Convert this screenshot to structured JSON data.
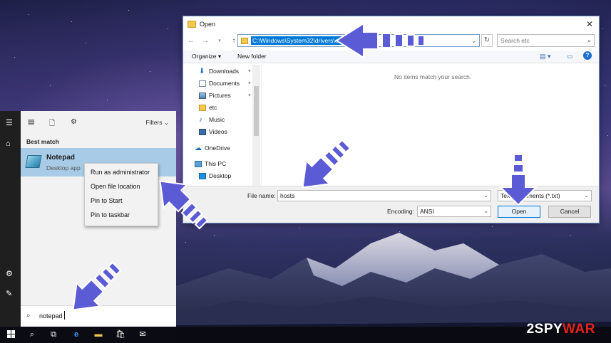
{
  "dialog": {
    "title": "Open",
    "address_path": "C:\\Windows\\System32\\drivers\\etc",
    "search_placeholder": "Search etc",
    "toolbar": {
      "organize": "Organize ▾",
      "new_folder": "New folder"
    },
    "nav_items": [
      {
        "label": "Downloads",
        "icon": "download-icon",
        "pinned": true
      },
      {
        "label": "Documents",
        "icon": "documents-icon",
        "pinned": true
      },
      {
        "label": "Pictures",
        "icon": "pictures-icon",
        "pinned": true
      },
      {
        "label": "etc",
        "icon": "folder-icon",
        "pinned": false
      },
      {
        "label": "Music",
        "icon": "music-icon",
        "pinned": false
      },
      {
        "label": "Videos",
        "icon": "videos-icon",
        "pinned": false
      },
      {
        "label": "OneDrive",
        "icon": "cloud-icon",
        "pinned": false
      },
      {
        "label": "This PC",
        "icon": "computer-icon",
        "pinned": false
      },
      {
        "label": "Desktop",
        "icon": "desktop-icon",
        "pinned": false
      }
    ],
    "empty_message": "No items match your search.",
    "file_name_label": "File name:",
    "file_name_value": "hosts",
    "file_type_value": "Text Documents (*.txt)",
    "encoding_label": "Encoding:",
    "encoding_value": "ANSI",
    "open_button": "Open",
    "cancel_button": "Cancel"
  },
  "start_menu": {
    "filters_label": "Filters",
    "best_match_label": "Best match",
    "result_name": "Notepad",
    "result_type": "Desktop app",
    "context_menu": [
      "Run as administrator",
      "Open file location",
      "Pin to Start",
      "Pin to taskbar"
    ],
    "search_text": "notepad"
  },
  "watermark": {
    "two": "2",
    "spy": "SPY",
    "war": "WAR"
  },
  "colors": {
    "accent": "#0078d7",
    "highlight": "#a8cce8",
    "arrow_fill": "#5b5bd6",
    "watermark_red": "#e5231b"
  }
}
